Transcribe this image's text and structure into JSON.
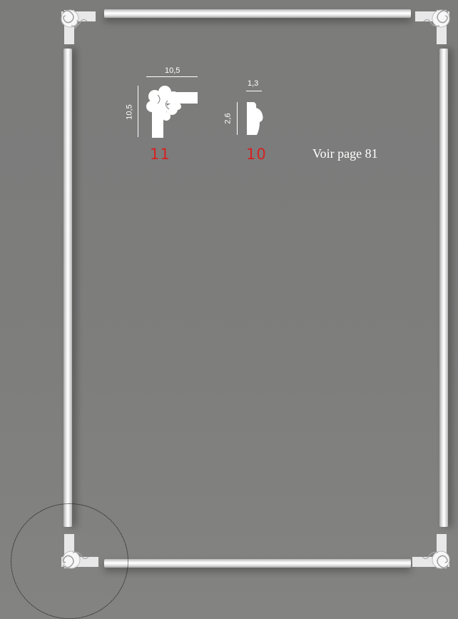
{
  "profile_11": {
    "width": "10,5",
    "height": "10,5",
    "number": "11"
  },
  "profile_10": {
    "width": "1,3",
    "height": "2,6",
    "number": "10"
  },
  "reference": "Voir page 81",
  "colors": {
    "background": "#7d7d7c",
    "number": "#d42222",
    "molding": "#f2f2f2"
  }
}
